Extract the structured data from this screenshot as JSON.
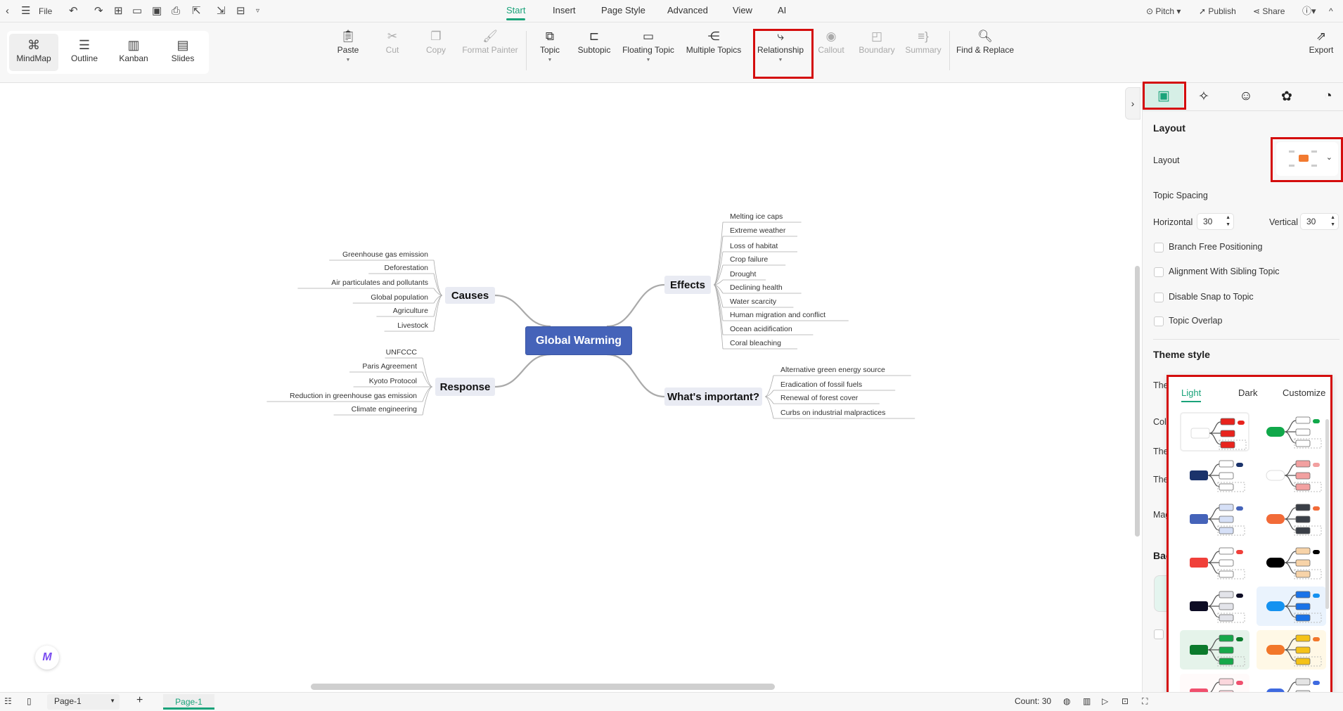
{
  "topbar": {
    "file": "File",
    "tabs": [
      "Start",
      "Insert",
      "Page Style",
      "Advanced",
      "View",
      "AI"
    ],
    "active_tab": "Start",
    "pitch": "Pitch",
    "publish": "Publish",
    "share": "Share"
  },
  "views": [
    "MindMap",
    "Outline",
    "Kanban",
    "Slides"
  ],
  "active_view": "MindMap",
  "tools": {
    "paste": "Paste",
    "cut": "Cut",
    "copy": "Copy",
    "format_painter": "Format Painter",
    "topic": "Topic",
    "subtopic": "Subtopic",
    "floating_topic": "Floating Topic",
    "multiple_topics": "Multiple Topics",
    "relationship": "Relationship",
    "callout": "Callout",
    "boundary": "Boundary",
    "summary": "Summary",
    "find_replace": "Find & Replace",
    "export": "Export"
  },
  "mindmap": {
    "central": "Global Warming",
    "branches": [
      {
        "label": "Causes",
        "children": [
          "Greenhouse gas emission",
          "Deforestation",
          "Air particulates and pollutants",
          "Global population",
          "Agriculture",
          "Livestock"
        ]
      },
      {
        "label": "Effects",
        "children": [
          "Melting ice caps",
          "Extreme weather",
          "Loss of habitat",
          "Crop failure",
          "Drought",
          "Declining health",
          "Water scarcity",
          "Human migration and conflict",
          "Ocean acidification",
          "Coral bleaching"
        ]
      },
      {
        "label": "Response",
        "children": [
          "UNFCCC",
          "Paris Agreement",
          "Kyoto Protocol",
          "Reduction in greenhouse gas emission",
          "Climate engineering"
        ]
      },
      {
        "label": "What's important?",
        "children": [
          "Alternative green energy source",
          "Eradication of fossil fuels",
          "Renewal of forest cover",
          "Curbs on industrial malpractices"
        ]
      }
    ]
  },
  "panel": {
    "layout_heading": "Layout",
    "layout_label": "Layout",
    "topic_spacing": "Topic Spacing",
    "horizontal_label": "Horizontal",
    "horizontal_value": "30",
    "vertical_label": "Vertical",
    "vertical_value": "30",
    "checkboxes": [
      "Branch Free Positioning",
      "Alignment With Sibling Topic",
      "Disable Snap to Topic",
      "Topic Overlap"
    ],
    "theme_heading": "Theme style",
    "hidden_labels": [
      "The",
      "Col",
      "The",
      "The",
      "Mag",
      "Bac"
    ]
  },
  "theme_popup": {
    "tabs": [
      "Light",
      "Dark",
      "Customize"
    ],
    "active": "Light",
    "themes": [
      {
        "main": "#ffffff",
        "sub": "#e8231d",
        "bg": "#ffffff"
      },
      {
        "main": "#10a84a",
        "sub": "#ffffff",
        "bg": "#ffffff"
      },
      {
        "main": "#1b336b",
        "sub": "#ffffff",
        "bg": "#ffffff"
      },
      {
        "main": "#ffffff",
        "sub": "#f2a0a0",
        "bg": "#ffffff"
      },
      {
        "main": "#4563b9",
        "sub": "#d6e0f7",
        "bg": "#ffffff"
      },
      {
        "main": "#f26b38",
        "sub": "#3a3f47",
        "bg": "#ffffff"
      },
      {
        "main": "#f0403a",
        "sub": "#ffffff",
        "bg": "#ffffff"
      },
      {
        "main": "#000000",
        "sub": "#f7d3a8",
        "bg": "#ffffff"
      },
      {
        "main": "#0d0c24",
        "sub": "#e3e4ea",
        "bg": "#ffffff"
      },
      {
        "main": "#1592f0",
        "sub": "#1a73e8",
        "bg": "#eaf3fd"
      },
      {
        "main": "#0b7a2c",
        "sub": "#16a84a",
        "bg": "#e5f3ea"
      },
      {
        "main": "#f2772a",
        "sub": "#f5c217",
        "bg": "#fff8e6"
      },
      {
        "main": "#f0506e",
        "sub": "#fbd6dc",
        "bg": "#fffafa"
      },
      {
        "main": "#3e6ae0",
        "sub": "#e4e4e4",
        "bg": "#ffffff"
      }
    ]
  },
  "bottombar": {
    "page_select": "Page-1",
    "page_tab": "Page-1",
    "count": "Count: 30"
  },
  "colors": {
    "accent": "#1aa37a",
    "central": "#4563b9",
    "highlight": "#d40d0d"
  }
}
